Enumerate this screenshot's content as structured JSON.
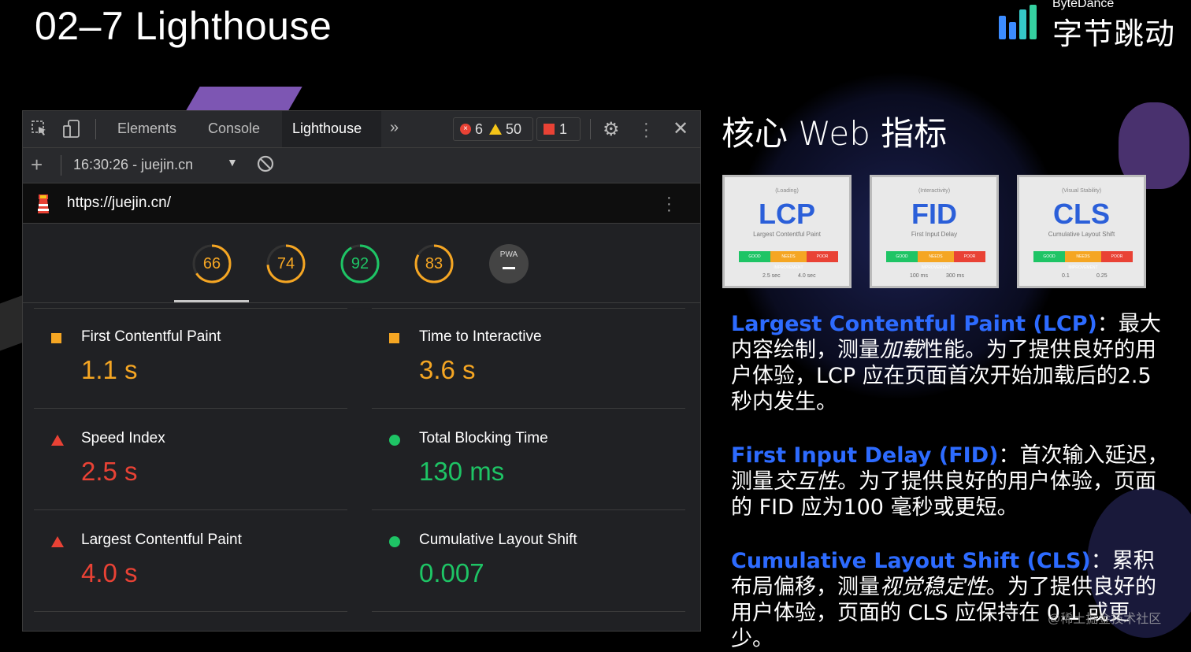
{
  "slide": {
    "title": "02–7 Lighthouse",
    "logo": {
      "small": "ByteDance",
      "big": "字节跳动"
    }
  },
  "devtools": {
    "tabs": [
      "Elements",
      "Console",
      "Lighthouse"
    ],
    "active_tab": "Lighthouse",
    "more": "»",
    "errors": "6",
    "warnings": "50",
    "issues": "1",
    "report_selector": "16:30:26 - juejin.cn",
    "url": "https://juejin.cn/",
    "scores": [
      {
        "value": "66",
        "color": "#f5a623"
      },
      {
        "value": "74",
        "color": "#f5a623"
      },
      {
        "value": "92",
        "color": "#1ec465"
      },
      {
        "value": "83",
        "color": "#f5a623"
      }
    ],
    "pwa_label": "PWA",
    "metrics": [
      {
        "label": "First Contentful Paint",
        "value": "1.1 s",
        "status": "average",
        "color": "#f5a623"
      },
      {
        "label": "Time to Interactive",
        "value": "3.6 s",
        "status": "average",
        "color": "#f5a623"
      },
      {
        "label": "Speed Index",
        "value": "2.5 s",
        "status": "fail",
        "color": "#e94235"
      },
      {
        "label": "Total Blocking Time",
        "value": "130 ms",
        "status": "pass",
        "color": "#1ec465"
      },
      {
        "label": "Largest Contentful Paint",
        "value": "4.0 s",
        "status": "fail",
        "color": "#e94235"
      },
      {
        "label": "Cumulative Layout Shift",
        "value": "0.007",
        "status": "pass",
        "color": "#1ec465"
      }
    ]
  },
  "core_web_vitals": {
    "title": "核心 Web 指标",
    "cards": [
      {
        "sub": "(Loading)",
        "big": "LCP",
        "desc": "Largest Contentful Paint",
        "bar": [
          "GOOD",
          "NEEDS IMPROVEMENT",
          "POOR"
        ],
        "ticks": [
          "2.5 sec",
          "4.0 sec"
        ]
      },
      {
        "sub": "(Interactivity)",
        "big": "FID",
        "desc": "First Input Delay",
        "bar": [
          "GOOD",
          "NEEDS IMPROVEMENT",
          "POOR"
        ],
        "ticks": [
          "100 ms",
          "300 ms"
        ]
      },
      {
        "sub": "(Visual Stability)",
        "big": "CLS",
        "desc": "Cumulative Layout Shift",
        "bar": [
          "GOOD",
          "NEEDS IMPROVEMENT",
          "POOR"
        ],
        "ticks": [
          "0.1",
          "0.25"
        ]
      }
    ],
    "paragraphs": [
      {
        "term": "Largest Contentful Paint (LCP)",
        "pre": "：最大内容绘制，测量",
        "em": "加载",
        "post": "性能。为了提供良好的用户体验，LCP 应在页面首次开始加载后的2.5秒内发生。"
      },
      {
        "term": "First Input Delay (FID)",
        "pre": "：首次输入延迟，测量",
        "em": "交互性",
        "post": "。为了提供良好的用户体验，页面的 FID 应为100 毫秒或更短。"
      },
      {
        "term": "Cumulative Layout Shift (CLS)",
        "pre": "：累积布局偏移，测量",
        "em": "视觉稳定性",
        "post": "。为了提供良好的用户体验，页面的 CLS 应保持在 0.1 或更少。"
      }
    ]
  },
  "watermark": "@稀土掘金技术社区",
  "colors": {
    "accent": "#2d6bff",
    "good": "#1ec465",
    "average": "#f5a623",
    "poor": "#e94235"
  }
}
